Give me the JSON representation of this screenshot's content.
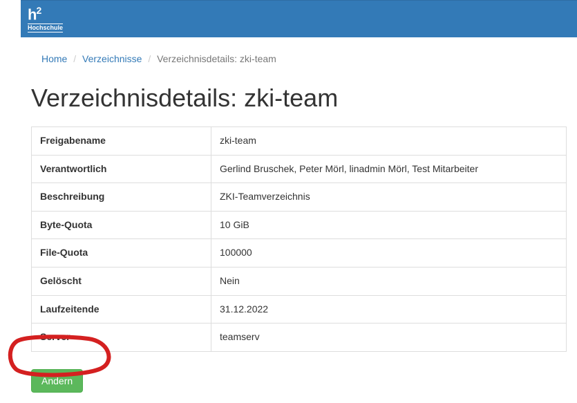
{
  "header": {
    "logo_main": "h²",
    "logo_sub": "Hochschule"
  },
  "breadcrumb": {
    "home": "Home",
    "directories": "Verzeichnisse",
    "current": "Verzeichnisdetails: zki-team"
  },
  "page_title": "Verzeichnisdetails: zki-team",
  "details": {
    "rows": [
      {
        "label": "Freigabename",
        "value": "zki-team"
      },
      {
        "label": "Verantwortlich",
        "value": "Gerlind Bruschek, Peter Mörl, linadmin Mörl, Test Mitarbeiter"
      },
      {
        "label": "Beschreibung",
        "value": "ZKI-Teamverzeichnis"
      },
      {
        "label": "Byte-Quota",
        "value": "10 GiB"
      },
      {
        "label": "File-Quota",
        "value": "100000"
      },
      {
        "label": "Gelöscht",
        "value": "Nein"
      },
      {
        "label": "Laufzeitende",
        "value": "31.12.2022"
      },
      {
        "label": "Server",
        "value": "teamserv"
      }
    ]
  },
  "buttons": {
    "edit": "Ändern"
  }
}
